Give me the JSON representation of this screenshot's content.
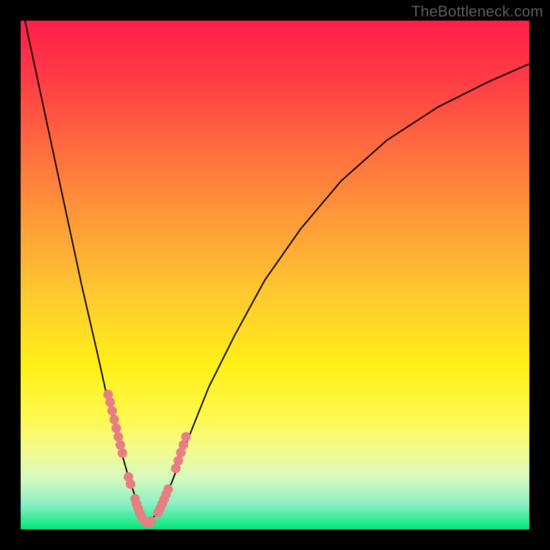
{
  "watermark": "TheBottleneck.com",
  "chart_data": {
    "type": "line",
    "title": "",
    "xlabel": "",
    "ylabel": "",
    "x_range": [
      0,
      100
    ],
    "y_range": [
      0,
      100
    ],
    "notes": "V-shaped bottleneck curve over a vertical red→yellow→green gradient. Curve minimum near x≈25. Y encodes bottleneck severity: red high, green low. Pink/coral beads mark data samples clustered near the trough.",
    "series": [
      {
        "name": "bottleneck-curve",
        "x": [
          0,
          3,
          6,
          9,
          12,
          15,
          17,
          19,
          21,
          23,
          24,
          25,
          26,
          28,
          30,
          33,
          37,
          42,
          48,
          55,
          63,
          72,
          82,
          92,
          100
        ],
        "y": [
          104,
          90,
          76,
          62,
          48,
          35,
          26,
          18,
          11,
          5,
          2.5,
          1.2,
          2.2,
          5,
          10,
          18,
          28,
          38,
          49,
          59,
          68.5,
          76.5,
          83,
          88,
          91.5
        ]
      }
    ],
    "bead_groups": [
      {
        "name": "left-arm-beads",
        "points": [
          [
            17.2,
            26.5
          ],
          [
            17.6,
            25.0
          ],
          [
            18.0,
            23.3
          ],
          [
            18.4,
            21.6
          ],
          [
            18.8,
            19.9
          ],
          [
            19.2,
            18.2
          ],
          [
            19.6,
            16.6
          ],
          [
            20.0,
            15.0
          ],
          [
            21.2,
            10.3
          ],
          [
            21.6,
            8.9
          ],
          [
            22.5,
            6.0
          ],
          [
            22.8,
            5.0
          ],
          [
            23.1,
            4.1
          ],
          [
            23.4,
            3.3
          ],
          [
            23.7,
            2.6
          ]
        ]
      },
      {
        "name": "trough-beads",
        "points": [
          [
            24.3,
            1.7
          ],
          [
            25.0,
            1.2
          ],
          [
            25.7,
            1.6
          ]
        ]
      },
      {
        "name": "right-arm-beads",
        "points": [
          [
            27.0,
            3.3
          ],
          [
            27.4,
            4.1
          ],
          [
            27.8,
            5.0
          ],
          [
            28.2,
            5.9
          ],
          [
            28.6,
            6.9
          ],
          [
            29.0,
            7.9
          ],
          [
            30.5,
            12.0
          ],
          [
            31.0,
            13.5
          ],
          [
            31.5,
            15.1
          ],
          [
            32.0,
            16.6
          ],
          [
            32.5,
            18.2
          ]
        ]
      }
    ]
  }
}
